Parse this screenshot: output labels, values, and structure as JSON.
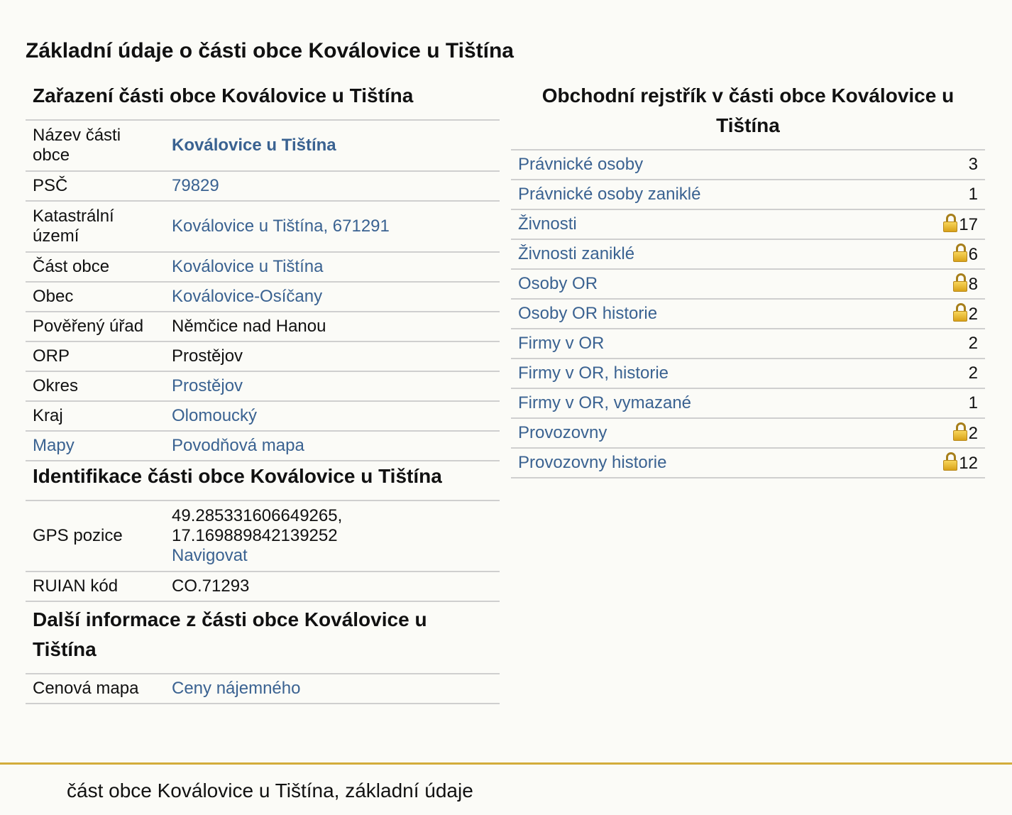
{
  "page_title": "Základní údaje o části obce Koválovice u Tištína",
  "zarazeni": {
    "title": "Zařazení části obce Koválovice u Tištína",
    "rows": [
      {
        "label": "Název části obce",
        "value": "Koválovice u Tištína"
      },
      {
        "label": "PSČ",
        "value": "79829"
      },
      {
        "label": "Katastrální území",
        "value": "Koválovice u Tištína, 671291"
      },
      {
        "label": "Část obce",
        "value": "Koválovice u Tištína"
      },
      {
        "label": "Obec",
        "value": "Koválovice-Osíčany"
      },
      {
        "label": "Pověřený úřad",
        "value": "Němčice nad Hanou"
      },
      {
        "label": "ORP",
        "value": "Prostějov"
      },
      {
        "label": "Okres",
        "value": "Prostějov"
      },
      {
        "label": "Kraj",
        "value": "Olomoucký"
      },
      {
        "label": "Mapy",
        "value": "Povodňová mapa"
      }
    ]
  },
  "identifikace": {
    "title": "Identifikace části obce Koválovice u Tištína",
    "gps_label": "GPS pozice",
    "gps_lat": "49.285331606649265,",
    "gps_lon": "17.169889842139252",
    "navigate_label": "Navigovat",
    "ruian_label": "RUIAN kód",
    "ruian_value": "CO.71293"
  },
  "dalsi": {
    "title": "Další informace z části obce Koválovice u Tištína",
    "rows": [
      {
        "label": "Cenová mapa",
        "value": "Ceny nájemného"
      }
    ]
  },
  "rejstrik": {
    "title": "Obchodní rejstřík v části obce Koválovice u Tištína",
    "rows": [
      {
        "label": "Právnické osoby",
        "count": "3",
        "locked": false
      },
      {
        "label": "Právnické osoby zaniklé",
        "count": "1",
        "locked": false
      },
      {
        "label": "Živnosti",
        "count": "17",
        "locked": true
      },
      {
        "label": "Živnosti zaniklé",
        "count": "6",
        "locked": true
      },
      {
        "label": "Osoby OR",
        "count": "8",
        "locked": true
      },
      {
        "label": "Osoby OR historie",
        "count": "2",
        "locked": true
      },
      {
        "label": "Firmy v OR",
        "count": "2",
        "locked": false
      },
      {
        "label": "Firmy v OR, historie",
        "count": "2",
        "locked": false
      },
      {
        "label": "Firmy v OR, vymazané",
        "count": "1",
        "locked": false
      },
      {
        "label": "Provozovny",
        "count": "2",
        "locked": true
      },
      {
        "label": "Provozovny historie",
        "count": "12",
        "locked": true
      }
    ]
  },
  "footer": {
    "text": "část obce Koválovice u Tištína, základní údaje"
  },
  "colors": {
    "link": "#3a6291",
    "footer_line": "#d3ad3c",
    "background": "#fbfbf7"
  }
}
